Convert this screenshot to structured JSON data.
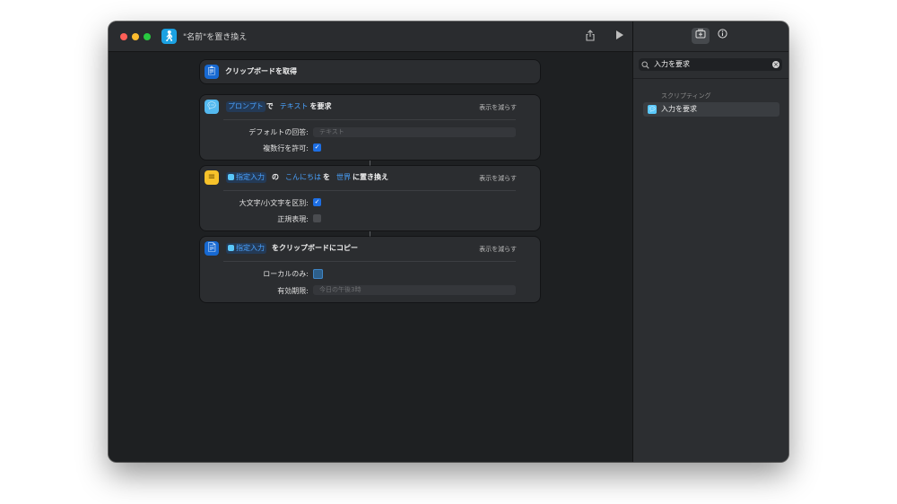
{
  "window": {
    "title": "\"名前\"を置き換え",
    "app_icon": "figure-walking-icon",
    "share_icon": "share-icon",
    "run_icon": "play-icon"
  },
  "sidebar": {
    "tabs": [
      {
        "icon": "action-library-icon",
        "active": true
      },
      {
        "icon": "info-icon",
        "active": false
      }
    ],
    "search": {
      "value": "入力を要求",
      "icon": "magnifying-glass-icon",
      "clear_icon": "clear-icon"
    },
    "section_title": "スクリプティング",
    "results": [
      {
        "label": "入力を要求",
        "icon": "ask-input-icon"
      }
    ]
  },
  "actions": [
    {
      "id": "get-clipboard",
      "icon": "clipboard-icon",
      "title": "クリップボードを取得"
    },
    {
      "id": "ask-for-input",
      "icon": "ask-input-icon",
      "phrase": {
        "token1": "プロンプト",
        "word1": "で",
        "token2": "テキスト",
        "word2": "を要求"
      },
      "show_less": "表示を減らす",
      "params": {
        "default_answer_label": "デフォルトの回答:",
        "default_answer_placeholder": "テキスト",
        "allow_multiline_label": "複数行を許可:",
        "allow_multiline": true
      }
    },
    {
      "id": "replace-text",
      "icon": "text-icon",
      "phrase": {
        "token1": "指定入力",
        "word1": "の",
        "token2": "こんにちは",
        "word2": "を",
        "token3": "世界",
        "word3": "に置き換え"
      },
      "show_less": "表示を減らす",
      "params": {
        "case_sensitive_label": "大文字/小文字を区別:",
        "case_sensitive": true,
        "regex_label": "正規表現:",
        "regex": false
      }
    },
    {
      "id": "copy-to-clipboard",
      "icon": "copy-icon",
      "phrase": {
        "token1": "指定入力",
        "word1": "をクリップボードにコピー"
      },
      "show_less": "表示を減らす",
      "params": {
        "local_only_label": "ローカルのみ:",
        "expire_label": "有効期限:",
        "expire_placeholder": "今日の午後3時"
      }
    }
  ],
  "colors": {
    "accent": "#1d6ee3",
    "token_text": "#4aa3ff",
    "panel": "#2b2d30",
    "background": "#1e2022"
  }
}
